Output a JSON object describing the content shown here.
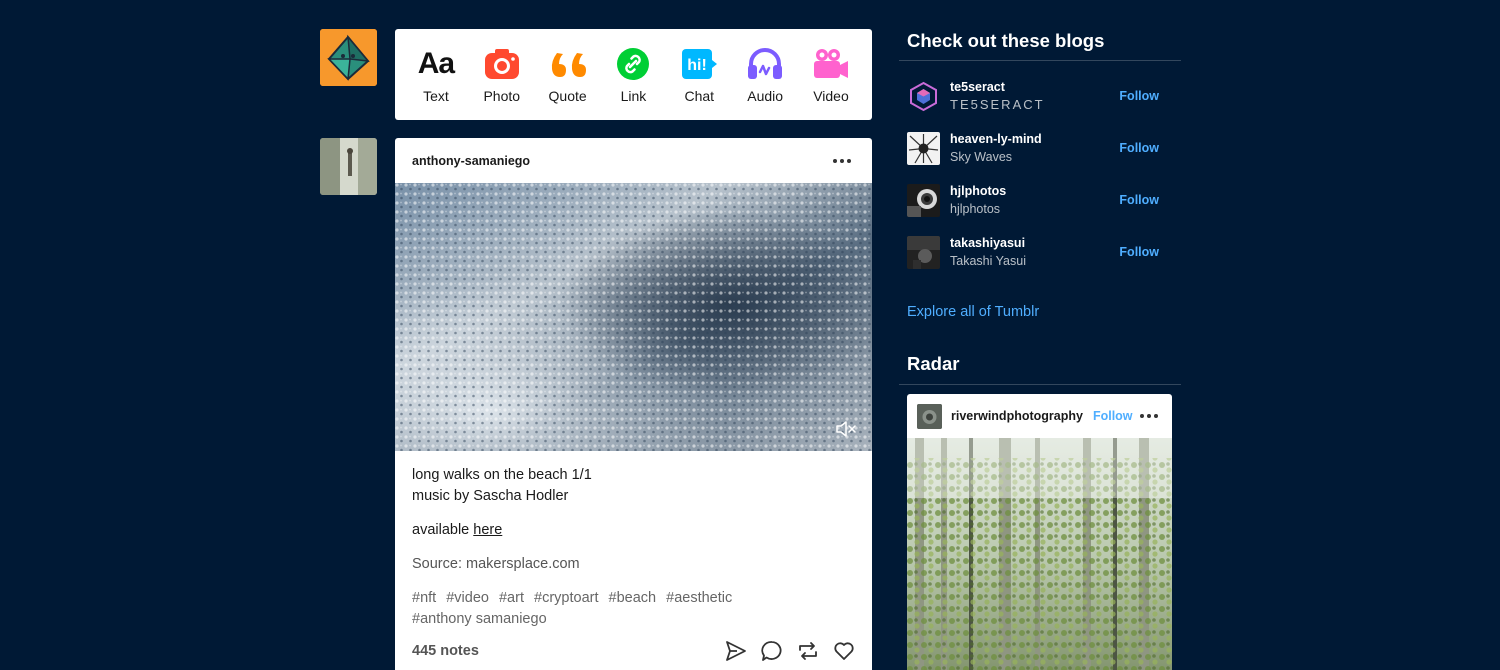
{
  "post_types": [
    {
      "label": "Text",
      "icon": "text-aa-icon",
      "color": "#111111"
    },
    {
      "label": "Photo",
      "icon": "camera-icon",
      "color": "#ff492f"
    },
    {
      "label": "Quote",
      "icon": "quote-icon",
      "color": "#ff8a00"
    },
    {
      "label": "Link",
      "icon": "link-icon",
      "color": "#00b8ff"
    },
    {
      "label": "Chat",
      "icon": "chat-hi-icon",
      "color": "#00cf35"
    },
    {
      "label": "Audio",
      "icon": "headphones-icon",
      "color": "#7c5cff"
    },
    {
      "label": "Video",
      "icon": "video-camera-icon",
      "color": "#ff62ce"
    }
  ],
  "post_type_text_glyph": "Aa",
  "post_type_chat_glyph": "hi!",
  "post": {
    "blog_name": "anthony-samaniego",
    "line1": "long walks on the beach 1/1",
    "line2": "music by Sascha Hodler",
    "available_prefix": "available ",
    "available_link": "here",
    "source": "Source: makersplace.com",
    "tags": [
      "#nft",
      "#video",
      "#art",
      "#cryptoart",
      "#beach",
      "#aesthetic",
      "#anthony samaniego"
    ],
    "notes": "445 notes"
  },
  "sidebar": {
    "recommended_title": "Check out these blogs",
    "blogs": [
      {
        "name": "te5seract",
        "title": "TE5SERACT",
        "follow": "Follow"
      },
      {
        "name": "heaven-ly-mind",
        "title": "Sky Waves",
        "follow": "Follow"
      },
      {
        "name": "hjlphotos",
        "title": "hjlphotos",
        "follow": "Follow"
      },
      {
        "name": "takashiyasui",
        "title": "Takashi Yasui",
        "follow": "Follow"
      }
    ],
    "explore_link": "Explore all of Tumblr",
    "radar_title": "Radar",
    "radar": {
      "blog": "riverwindphotography",
      "follow": "Follow"
    }
  },
  "colors": {
    "background": "#001935",
    "link_blue": "#4faeff",
    "avatar_orange": "#f7982c"
  }
}
